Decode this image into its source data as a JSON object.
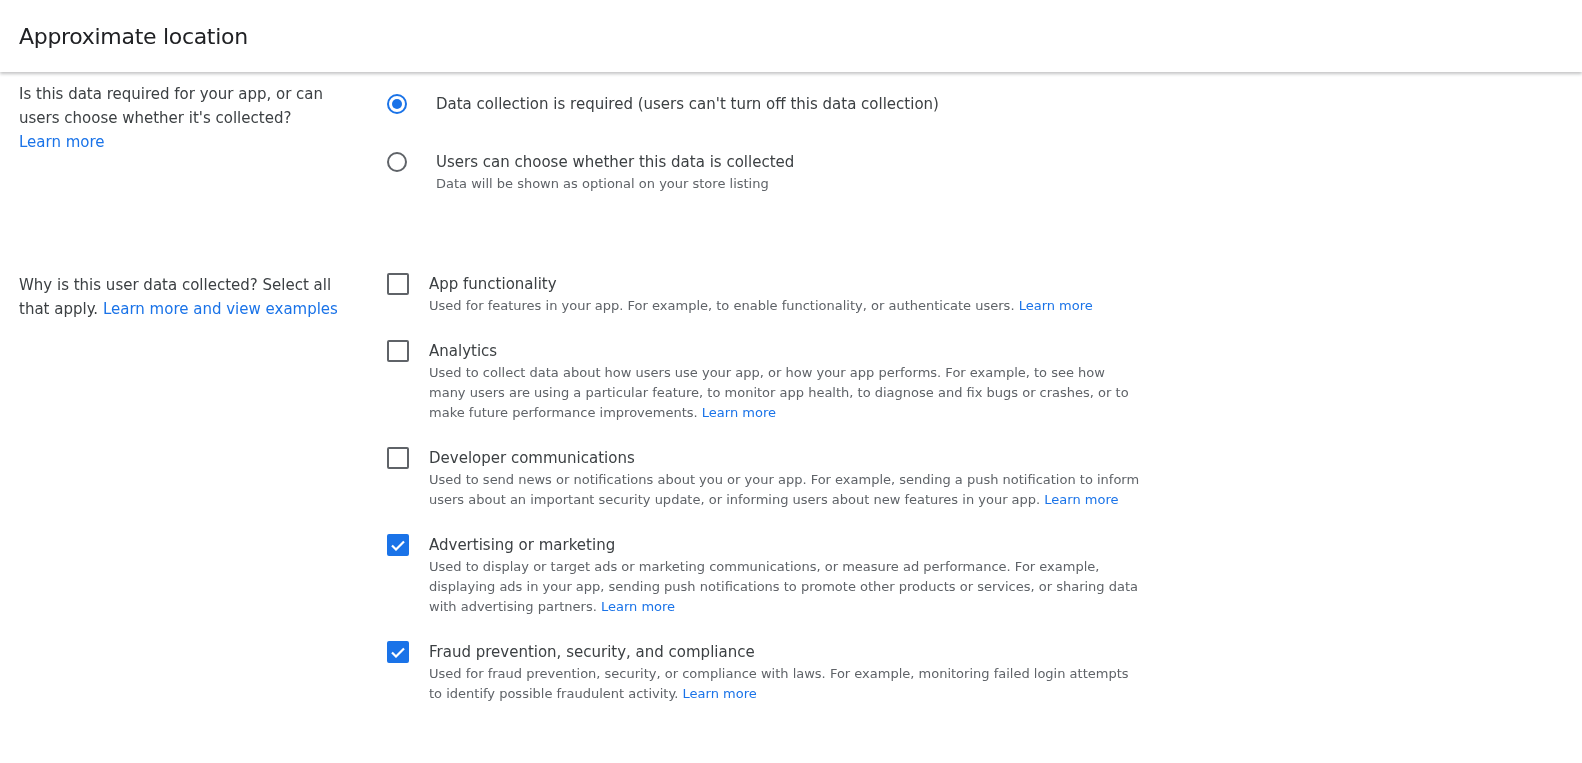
{
  "header": {
    "title": "Approximate location"
  },
  "questions": [
    {
      "kind": "radio",
      "text": "Is this data required for your app, or can users choose whether it's collected?",
      "link": "Learn more",
      "options": [
        {
          "label": "Data collection is required (users can't turn off this data collection)",
          "selected": true
        },
        {
          "label": "Users can choose whether this data is collected",
          "hint": "Data will be shown as optional on your store listing",
          "selected": false
        }
      ]
    },
    {
      "kind": "checkbox",
      "text": "Why is this user data collected? Select all that apply.",
      "link": "Learn more and view examples",
      "options": [
        {
          "label": "App functionality",
          "description": "Used for features in your app. For example, to enable functionality, or authenticate users.",
          "link": "Learn more",
          "checked": false
        },
        {
          "label": "Analytics",
          "description": "Used to collect data about how users use your app, or how your app performs. For example, to see how many users are using a particular feature, to monitor app health, to diagnose and fix bugs or crashes, or to make future performance improvements.",
          "link": "Learn more",
          "checked": false
        },
        {
          "label": "Developer communications",
          "description": "Used to send news or notifications about you or your app. For example, sending a push notification to inform users about an important security update, or informing users about new features in your app.",
          "link": "Learn more",
          "checked": false
        },
        {
          "label": "Advertising or marketing",
          "description": "Used to display or target ads or marketing communications, or measure ad performance. For example, displaying ads in your app, sending push notifications to promote other products or services, or sharing data with advertising partners.",
          "link": "Learn more",
          "checked": true
        },
        {
          "label": "Fraud prevention, security, and compliance",
          "description": "Used for fraud prevention, security, or compliance with laws. For example, monitoring failed login attempts to identify possible fraudulent activity.",
          "link": "Learn more",
          "checked": true
        }
      ]
    }
  ]
}
